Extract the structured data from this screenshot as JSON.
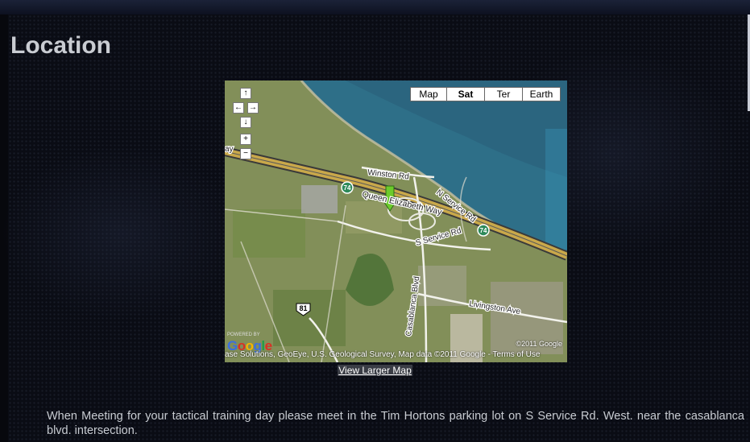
{
  "page": {
    "title": "Location"
  },
  "map": {
    "types": [
      {
        "label": "Map",
        "active": false
      },
      {
        "label": "Sat",
        "active": true
      },
      {
        "label": "Ter",
        "active": false
      },
      {
        "label": "Earth",
        "active": false
      }
    ],
    "controls": {
      "pan_up": "↑",
      "pan_left": "←",
      "pan_right": "→",
      "pan_down": "↓",
      "zoom_in": "+",
      "zoom_out": "−"
    },
    "roads": {
      "winston": "Winston Rd",
      "qew": "Queen Elizabeth Way",
      "n_service": "N Service Rd",
      "s_service": "S Service Rd",
      "livingston": "Livingston Ave",
      "casablanca": "Casablanca Blvd",
      "shield_74a": "74",
      "shield_74b": "74",
      "shield_81": "81",
      "edge_label": "ay"
    },
    "powered_by": "POWERED BY",
    "logo": "Google",
    "copyright": "©2011 Google",
    "attribution": "ase Solutions, GeoEye, U.S. Geological Survey, Map data ©2011 Google - Terms of Use",
    "view_larger": "View Larger Map"
  },
  "description": "When Meeting for your tactical training day please meet in the Tim Hortons parking lot on S Service Rd. West. near the casablanca blvd. intersection.",
  "colors": {
    "background": "#0a0c14",
    "title": "#c9ccd2",
    "water": "#2e6f88",
    "highway": "#c9a84a",
    "marker": "#6ccb2c"
  }
}
